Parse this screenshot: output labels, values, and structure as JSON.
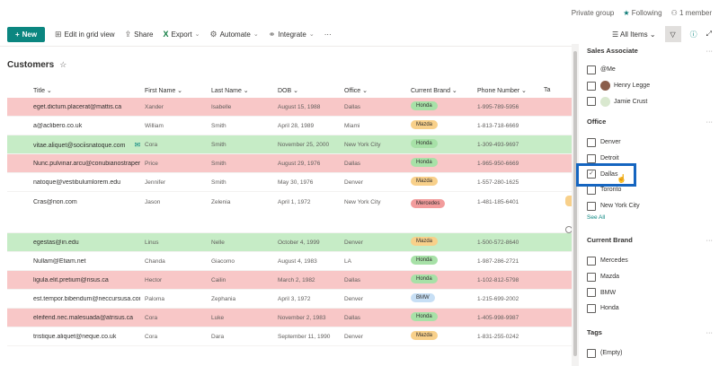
{
  "topbar": {
    "privacy": "Private group",
    "following": "Following",
    "members": "1 member"
  },
  "command_bar": {
    "new": "New",
    "edit_grid": "Edit in grid view",
    "share": "Share",
    "export": "Export",
    "automate": "Automate",
    "integrate": "Integrate",
    "more": "···",
    "view": "All Items"
  },
  "list": {
    "title": "Customers",
    "columns": [
      "Title",
      "First Name",
      "Last Name",
      "DOB",
      "Office",
      "Current Brand",
      "Phone Number",
      "Ta"
    ],
    "rows": [
      {
        "title": "eget.dictum.placerat@mattis.ca",
        "first": "Xander",
        "last": "Isabelle",
        "dob": "August 15, 1988",
        "office": "Dallas",
        "brand": "Honda",
        "phone": "1-995-789-5956",
        "color": "red"
      },
      {
        "title": "a@aclibero.co.uk",
        "first": "William",
        "last": "Smith",
        "dob": "April 28, 1989",
        "office": "Miami",
        "brand": "Mazda",
        "phone": "1-813-718-6669",
        "color": ""
      },
      {
        "title": "vitae.aliquet@sociisnatoque.com",
        "first": "Cora",
        "last": "Smith",
        "dob": "November 25, 2000",
        "office": "New York City",
        "brand": "Honda",
        "phone": "1-309-493-9697",
        "color": "green",
        "comment": true
      },
      {
        "title": "Nunc.pulvinar.arcu@conubianostraper.edu",
        "first": "Price",
        "last": "Smith",
        "dob": "August 29, 1976",
        "office": "Dallas",
        "brand": "Honda",
        "phone": "1-965-950-6669",
        "color": "red"
      },
      {
        "title": "natoque@vestibulumlorem.edu",
        "first": "Jennifer",
        "last": "Smith",
        "dob": "May 30, 1976",
        "office": "Denver",
        "brand": "Mazda",
        "phone": "1-557-280-1625",
        "color": ""
      },
      {
        "title": "Cras@non.com",
        "first": "Jason",
        "last": "Zelenia",
        "dob": "April 1, 1972",
        "office": "New York City",
        "brand": "Mercedes",
        "phone": "1-481-185-6401",
        "color": "",
        "tall": true
      },
      {
        "title": "egestas@in.edu",
        "first": "Linus",
        "last": "Nelle",
        "dob": "October 4, 1999",
        "office": "Denver",
        "brand": "Mazda",
        "phone": "1-500-572-8640",
        "color": "green"
      },
      {
        "title": "Nullam@Etiam.net",
        "first": "Chanda",
        "last": "Giacomo",
        "dob": "August 4, 1983",
        "office": "LA",
        "brand": "Honda",
        "phone": "1-987-286-2721",
        "color": ""
      },
      {
        "title": "ligula.elit.pretium@risus.ca",
        "first": "Hector",
        "last": "Cailin",
        "dob": "March 2, 1982",
        "office": "Dallas",
        "brand": "Honda",
        "phone": "1-102-812-5798",
        "color": "red"
      },
      {
        "title": "est.tempor.bibendum@neccursusa.com",
        "first": "Paloma",
        "last": "Zephania",
        "dob": "April 3, 1972",
        "office": "Denver",
        "brand": "BMW",
        "phone": "1-215-699-2002",
        "color": ""
      },
      {
        "title": "eleifend.nec.malesuada@atrisus.ca",
        "first": "Cora",
        "last": "Luke",
        "dob": "November 2, 1983",
        "office": "Dallas",
        "brand": "Honda",
        "phone": "1-405-998-9987",
        "color": "red"
      },
      {
        "title": "tristique.aliquet@neque.co.uk",
        "first": "Cora",
        "last": "Dara",
        "dob": "September 11, 1990",
        "office": "Denver",
        "brand": "Mazda",
        "phone": "1-831-255-0242",
        "color": ""
      }
    ]
  },
  "filters": {
    "sales_associate": {
      "heading": "Sales Associate",
      "options": [
        "@Me",
        "Henry Legge",
        "Jamie Crust"
      ]
    },
    "office": {
      "heading": "Office",
      "options": [
        "Denver",
        "Detroit",
        "Dallas",
        "Toronto",
        "New York City"
      ],
      "see_all": "See All"
    },
    "brand": {
      "heading": "Current Brand",
      "options": [
        "Mercedes",
        "Mazda",
        "BMW",
        "Honda"
      ]
    },
    "tags": {
      "heading": "Tags",
      "options": [
        "(Empty)"
      ]
    },
    "more": "···"
  },
  "colors": {
    "accent": "#0b8680",
    "row_red": "#f8c7c7",
    "row_green": "#c6ecc6",
    "highlight": "#1565c0"
  }
}
